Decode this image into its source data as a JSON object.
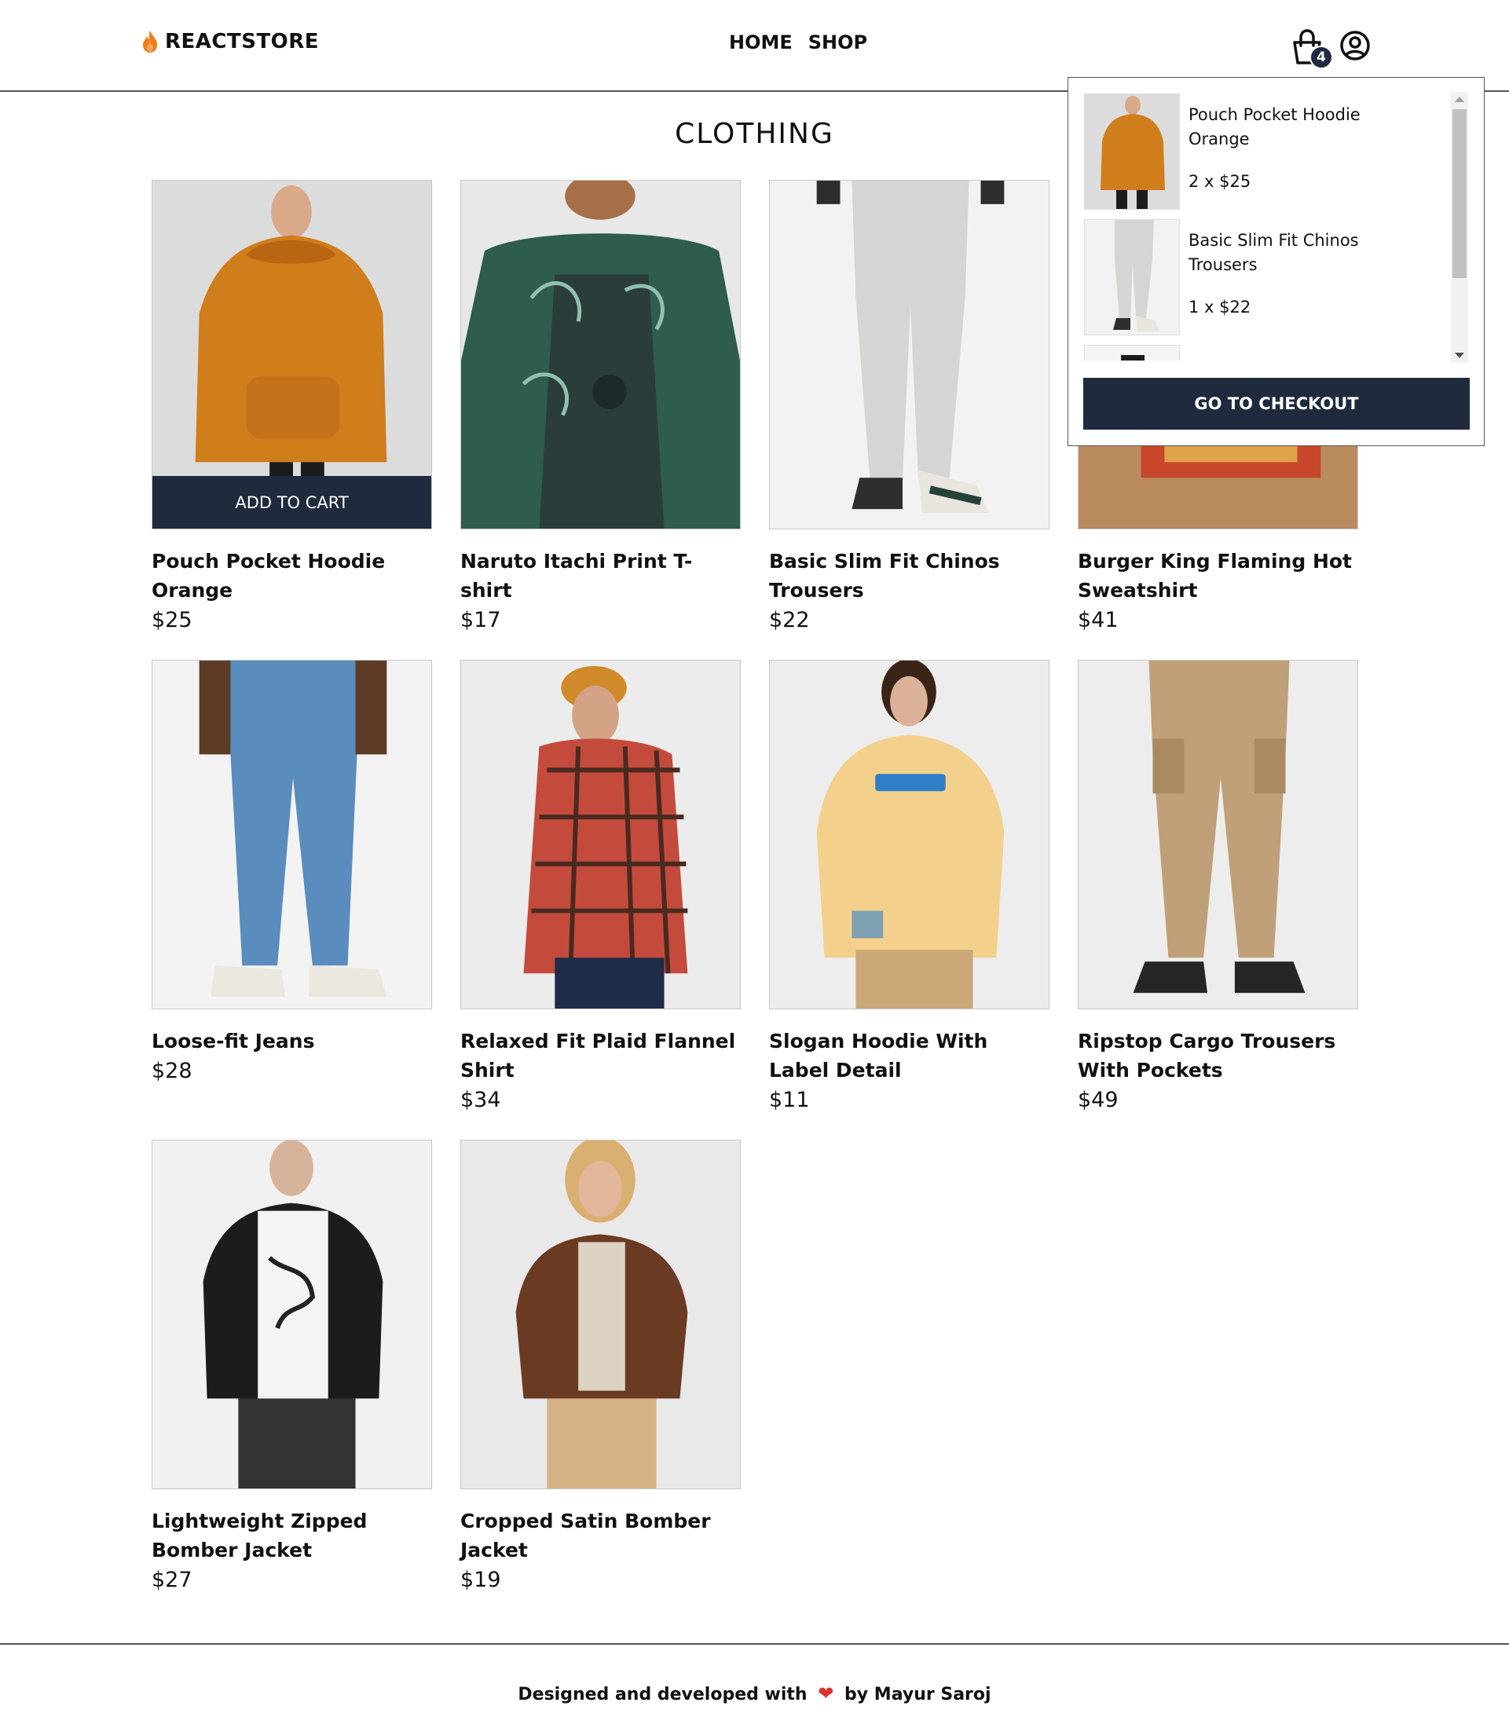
{
  "brand": {
    "name": "REACTSTORE"
  },
  "nav": {
    "home": "HOME",
    "shop": "SHOP"
  },
  "cart": {
    "count": "4"
  },
  "page": {
    "title": "CLOTHING"
  },
  "products": [
    {
      "name": "Pouch Pocket Hoodie Orange",
      "price": "$25",
      "add_label": "ADD TO CART"
    },
    {
      "name": "Naruto Itachi Print T-shirt",
      "price": "$17"
    },
    {
      "name": "Basic Slim Fit Chinos Trousers",
      "price": "$22"
    },
    {
      "name": "Burger King Flaming Hot Sweatshirt",
      "price": "$41"
    },
    {
      "name": "Loose-fit Jeans",
      "price": "$28"
    },
    {
      "name": "Relaxed Fit Plaid Flannel Shirt",
      "price": "$34"
    },
    {
      "name": "Slogan Hoodie With Label Detail",
      "price": "$11"
    },
    {
      "name": "Ripstop Cargo Trousers With Pockets",
      "price": "$49"
    },
    {
      "name": "Lightweight Zipped Bomber Jacket",
      "price": "$27"
    },
    {
      "name": "Cropped Satin Bomber Jacket",
      "price": "$19"
    }
  ],
  "dropdown": {
    "items": [
      {
        "name": "Pouch Pocket Hoodie Orange",
        "qty": "2 x $25"
      },
      {
        "name": "Basic Slim Fit Chinos Trousers",
        "qty": "1 x $22"
      }
    ],
    "checkout_label": "GO TO CHECKOUT"
  },
  "footer": {
    "before": "Designed and developed with",
    "after": "by Mayur Saroj"
  },
  "colors": {
    "primary_dark": "#1f2a3d",
    "heart": "#e0302c",
    "flame": "#f07d1a"
  }
}
